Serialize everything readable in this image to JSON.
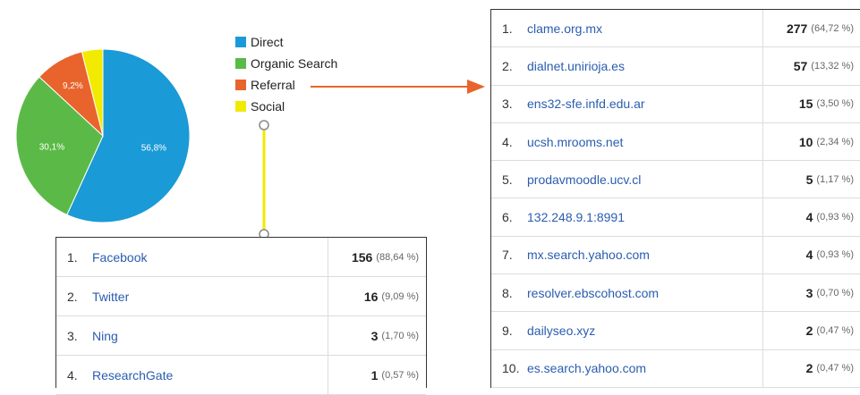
{
  "chart_data": {
    "type": "pie",
    "slices": [
      {
        "label": "Direct",
        "value": 56.8,
        "display": "56,8%",
        "color": "#1a9ad6"
      },
      {
        "label": "Organic Search",
        "value": 30.1,
        "display": "30,1%",
        "color": "#5bba47"
      },
      {
        "label": "Referral",
        "value": 9.2,
        "display": "9,2%",
        "color": "#e8642c"
      },
      {
        "label": "Social",
        "value": 3.9,
        "display": "",
        "color": "#f2ea00"
      }
    ]
  },
  "legend": [
    "Direct",
    "Organic Search",
    "Referral",
    "Social"
  ],
  "social_table": {
    "rows": [
      {
        "idx": "1.",
        "name": "Facebook",
        "count": "156",
        "pct": "(88,64 %)"
      },
      {
        "idx": "2.",
        "name": "Twitter",
        "count": "16",
        "pct": "(9,09 %)"
      },
      {
        "idx": "3.",
        "name": "Ning",
        "count": "3",
        "pct": "(1,70 %)"
      },
      {
        "idx": "4.",
        "name": "ResearchGate",
        "count": "1",
        "pct": "(0,57 %)"
      }
    ]
  },
  "referral_table": {
    "rows": [
      {
        "idx": "1.",
        "name": "clame.org.mx",
        "count": "277",
        "pct": "(64,72 %)"
      },
      {
        "idx": "2.",
        "name": "dialnet.unirioja.es",
        "count": "57",
        "pct": "(13,32 %)"
      },
      {
        "idx": "3.",
        "name": "ens32-sfe.infd.edu.ar",
        "count": "15",
        "pct": "(3,50 %)"
      },
      {
        "idx": "4.",
        "name": "ucsh.mrooms.net",
        "count": "10",
        "pct": "(2,34 %)"
      },
      {
        "idx": "5.",
        "name": "prodavmoodle.ucv.cl",
        "count": "5",
        "pct": "(1,17 %)"
      },
      {
        "idx": "6.",
        "name": "132.248.9.1:8991",
        "count": "4",
        "pct": "(0,93 %)"
      },
      {
        "idx": "7.",
        "name": "mx.search.yahoo.com",
        "count": "4",
        "pct": "(0,93 %)"
      },
      {
        "idx": "8.",
        "name": "resolver.ebscohost.com",
        "count": "3",
        "pct": "(0,70 %)"
      },
      {
        "idx": "9.",
        "name": "dailyseo.xyz",
        "count": "2",
        "pct": "(0,47 %)"
      },
      {
        "idx": "10.",
        "name": "es.search.yahoo.com",
        "count": "2",
        "pct": "(0,47 %)"
      }
    ]
  },
  "colors": {
    "social_connector": "#f2ea00",
    "referral_arrow": "#e8642c"
  }
}
